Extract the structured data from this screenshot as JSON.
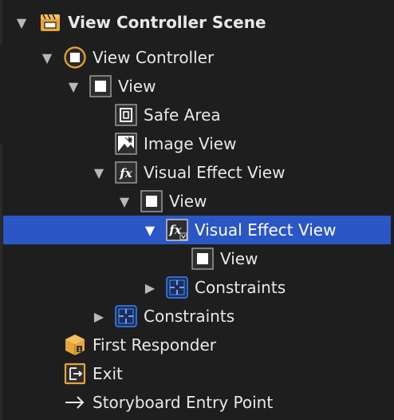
{
  "outline": {
    "scene": {
      "label": "View Controller Scene",
      "icon": "scene-icon"
    },
    "view_controller": {
      "label": "View Controller",
      "icon": "view-controller-icon"
    },
    "view": {
      "label": "View",
      "icon": "view-icon"
    },
    "safe_area": {
      "label": "Safe Area",
      "icon": "safe-area-icon"
    },
    "image_view": {
      "label": "Image View",
      "icon": "image-view-icon"
    },
    "visual_effect_view": {
      "label": "Visual Effect View",
      "icon": "visual-effect-icon"
    },
    "inner_view": {
      "label": "View",
      "icon": "view-icon"
    },
    "nested_visual_effect_view": {
      "label": "Visual Effect View",
      "icon": "visual-effect-vibrancy-icon",
      "selected": true
    },
    "nested_view": {
      "label": "View",
      "icon": "view-icon"
    },
    "inner_constraints": {
      "label": "Constraints",
      "icon": "constraints-icon"
    },
    "outer_constraints": {
      "label": "Constraints",
      "icon": "constraints-icon"
    },
    "first_responder": {
      "label": "First Responder",
      "icon": "first-responder-icon"
    },
    "exit": {
      "label": "Exit",
      "icon": "exit-icon"
    },
    "entry_point": {
      "label": "Storyboard Entry Point",
      "icon": "arrow-right-icon"
    }
  },
  "colors": {
    "background": "#1e1e1e",
    "selection": "#2a56c6",
    "scene_orange": "#e9a43a",
    "constraints_blue": "#3b82f6"
  }
}
